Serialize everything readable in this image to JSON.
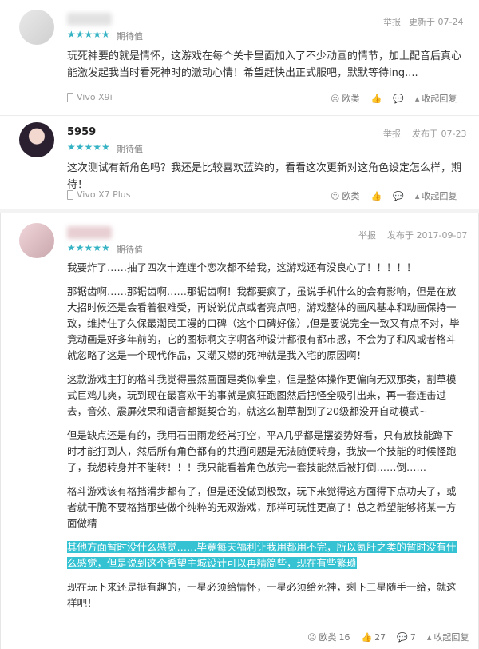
{
  "reviews": [
    {
      "name": "",
      "rating_label": "期待值",
      "stars": "★★★★★",
      "report": "举报",
      "date_label": "更新于 07-24",
      "text": "玩死神要的就是情怀，这游戏在每个关卡里面加入了不少动画的情节，加上配音后真心能激发起我当时看死神时的激动心情！希望赶快出正式服吧，默默等待ing....",
      "device": "Vivo X9i",
      "dislike": "欧类",
      "collapse": "收起回复"
    },
    {
      "name": "5959",
      "rating_label": "期待值",
      "stars": "★★★★★",
      "report": "举报",
      "date_label": "发布于 07-23",
      "text": "这次测试有新角色吗？我还是比较喜欢蓝染的，看看这次更新对这角色设定怎么样，期待！",
      "device": "Vivo X7 Plus",
      "dislike": "欧类",
      "collapse": "收起回复"
    },
    {
      "name": "",
      "rating_label": "期待值",
      "stars": "★★★★★",
      "report": "举报",
      "date_label": "发布于 2017-09-07",
      "paragraphs": [
        "我要炸了……抽了四次十连连个恋次都不给我，这游戏还有没良心了！！！！！",
        "那锯齿啊……那锯齿啊……那锯齿啊！我都要疯了，虽说手机什么的会有影响，但是在放大招时候还是会看着很难受，再说说优点或者亮点吧，游戏整体的画风基本和动画保持一致，维持住了久保最潮民工漫的口碑（这个口碑好像）,但是要说完全一致又有点不对，毕竟动画是好多年前的，它的图标啊文字啊各种设计都很有都市感，不会为了和风或者格斗就忽略了这是一个现代作品，又潮又燃的死神就是我入宅的原因啊！",
        "这款游戏主打的格斗我觉得虽然画面是类似拳皇，但是整体操作更偏向无双那类，割草模式巨鸡儿爽，玩到现在最喜欢干的事就是疯狂跑图然后把怪全吸引出来，再一套连击过去，音效、震屏效果和语音都挺契合的，就这么割草割到了20级都没开自动模式~",
        "但是缺点还是有的，我用石田雨龙经常打空，平A几乎都是摆姿势好看，只有放技能蹲下时才能打到人，然后所有角色都有的共通问题是无法随便转身，我放一个技能的时候怪跑了，我想转身并不能转！！！我只能看着角色放完一套技能然后被打倒……倒……",
        "格斗游戏该有格挡滑步都有了，但是还没做到极致，玩下来觉得这方面得下点功夫了，或者就干脆不要格挡那些做个纯粹的无双游戏，那样可玩性更高了！总之希望能够将某一方面做精"
      ],
      "highlight": "其他方面暂时没什么感觉……毕竟每天福利让我用都用不完，所以氪肝之类的暂时没有什么感觉，但是说到这个希望主城设计可以再精简些，现在有些繁琐",
      "closing": "现在玩下来还是挺有趣的，一星必须给情怀，一星必须给死神，剩下三星随手一给，就这样吧！",
      "dislike": "欧类",
      "dislike_count": "16",
      "like_count": "27",
      "comment_count": "7",
      "collapse": "收起回复"
    }
  ]
}
